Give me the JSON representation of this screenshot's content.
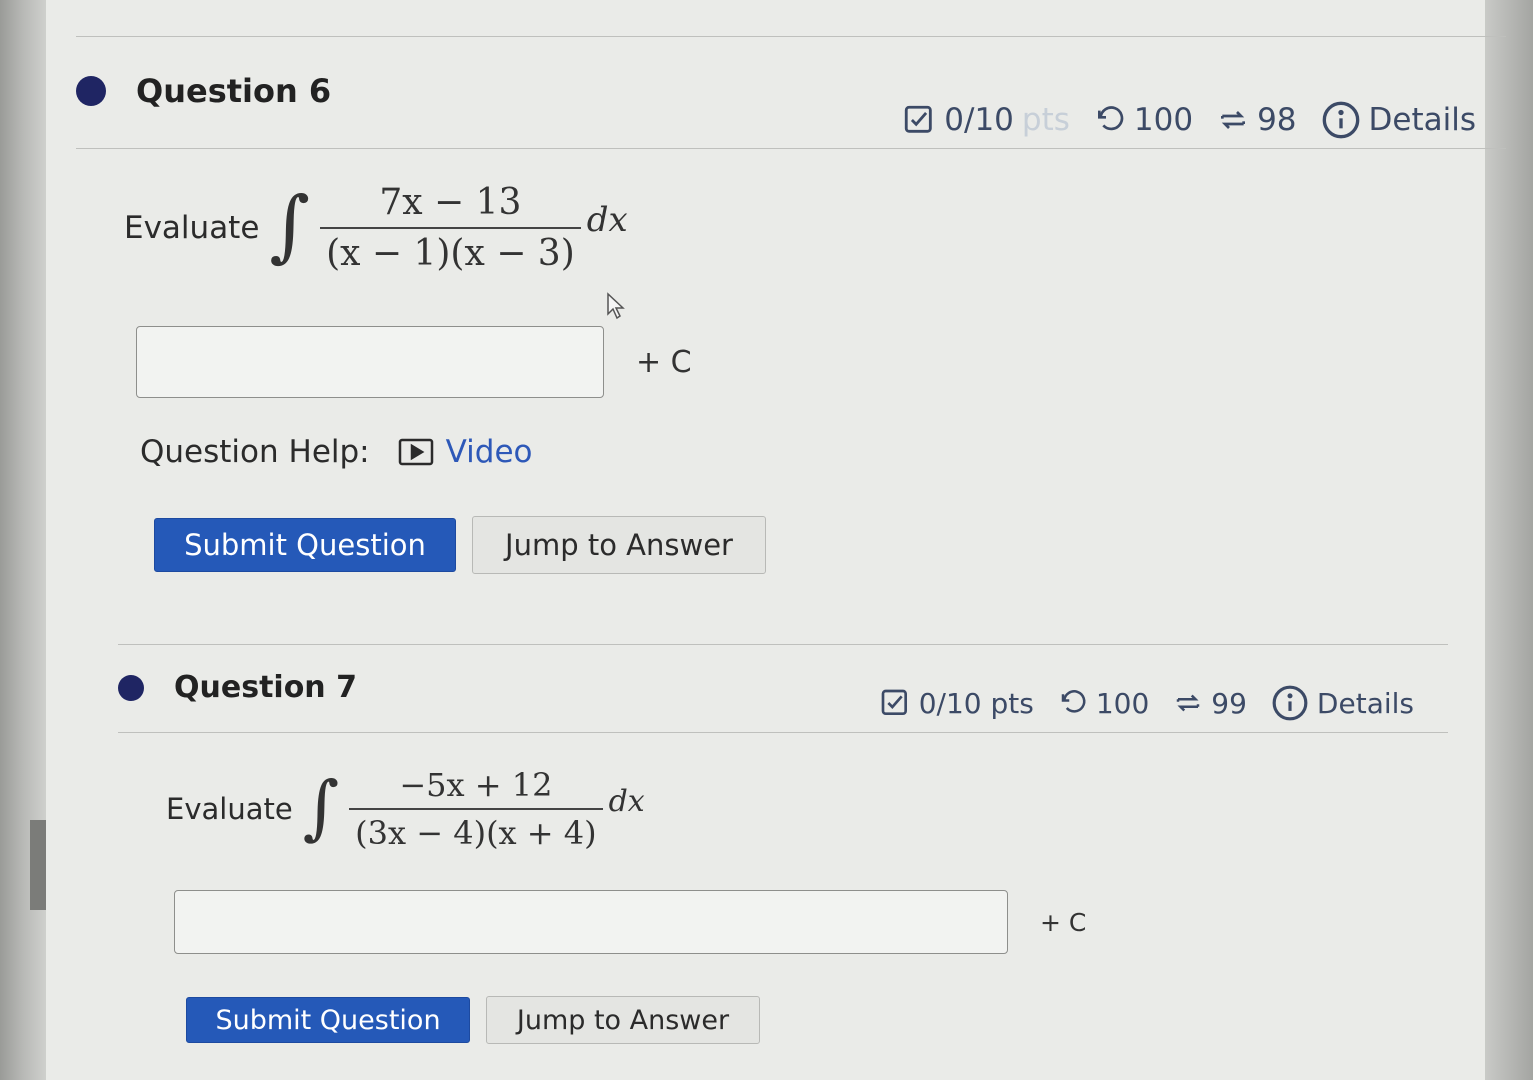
{
  "questions": [
    {
      "title": "Question 6",
      "score": "0/10",
      "score_unit": "pts",
      "attempts": "100",
      "retries": "98",
      "details_label": "Details",
      "evaluate_label": "Evaluate",
      "integral_symbol": "∫",
      "numerator": "7x − 13",
      "denominator": "(x − 1)(x − 3)",
      "differential": "dx",
      "answer_value": "",
      "plus_c": "+ C",
      "help_label": "Question Help:",
      "video_label": "Video",
      "submit_label": "Submit Question",
      "jump_label": "Jump to Answer"
    },
    {
      "title": "Question 7",
      "score": "0/10 pts",
      "attempts": "100",
      "retries": "99",
      "details_label": "Details",
      "evaluate_label": "Evaluate",
      "integral_symbol": "∫",
      "numerator": "−5x + 12",
      "denominator": "(3x − 4)(x + 4)",
      "differential": "dx",
      "answer_value": "",
      "plus_c": "+ C",
      "submit_label": "Submit Question",
      "jump_label": "Jump to Answer"
    }
  ],
  "colors": {
    "bullet": "#1f2563",
    "primary_button": "#2559b8",
    "link": "#2d58b8",
    "meta_text": "#3c4a66"
  },
  "icons": {
    "score": "checkbox-edit-icon",
    "attempts": "undo-icon",
    "retries": "retry-icon",
    "details": "info-circle-icon",
    "video": "video-play-icon",
    "cursor": "mouse-pointer-icon"
  }
}
